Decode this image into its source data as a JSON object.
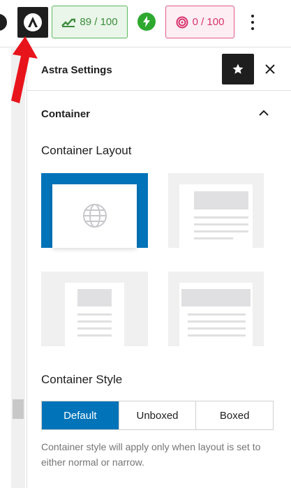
{
  "toolbar": {
    "seo_score": "89 / 100",
    "readability_score": "0 / 100"
  },
  "panel": {
    "title": "Astra Settings",
    "section_title": "Container",
    "layout_label": "Container Layout",
    "style_label": "Container Style",
    "style_options": [
      "Default",
      "Unboxed",
      "Boxed"
    ],
    "selected_style": "Default",
    "help_text": "Container style will apply only when layout is set to either normal or narrow."
  },
  "colors": {
    "accent": "#0073b9",
    "seo_green": "#3d8b3d",
    "readability_pink": "#d6336c",
    "annotation_red": "#e8141b"
  },
  "icons": [
    "astra-logo-icon",
    "seo-graph-icon",
    "bolt-icon",
    "readability-icon",
    "kebab-menu-icon",
    "star-icon",
    "close-icon",
    "chevron-up-icon",
    "globe-icon"
  ]
}
